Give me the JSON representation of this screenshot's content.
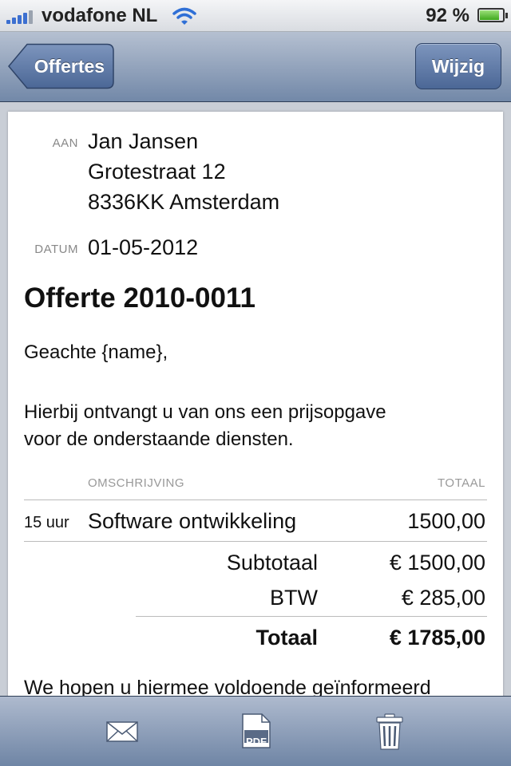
{
  "status_bar": {
    "carrier": "vodafone NL",
    "battery": "92 %",
    "battery_level": 0.92
  },
  "nav": {
    "back_label": "Offertes",
    "edit_label": "Wijzig"
  },
  "quote": {
    "to_label": "AAN",
    "to_name": "Jan Jansen",
    "to_street": "Grotestraat 12",
    "to_city": "8336KK Amsterdam",
    "date_label": "DATUM",
    "date": "01-05-2012",
    "title": "Offerte 2010-0011",
    "greeting": "Geachte {name},",
    "intro_line1": "Hierbij ontvangt u van ons een prijsopgave",
    "intro_line2": "voor de onderstaande diensten.",
    "col_description": "OMSCHRIJVING",
    "col_total": "TOTAAL",
    "items": [
      {
        "qty": "15 uur",
        "description": "Software ontwikkeling",
        "total": "1500,00"
      }
    ],
    "subtotal_label": "Subtotaal",
    "subtotal": "€ 1500,00",
    "vat_label": "BTW",
    "vat": "€ 285,00",
    "total_label": "Totaal",
    "total": "€ 1785,00",
    "closing": "We hopen u hiermee voldoende geïnformeerd"
  },
  "toolbar": {
    "icons": [
      "mail-icon",
      "pdf-icon",
      "trash-icon"
    ],
    "pdf_text": "PDF"
  },
  "colors": {
    "nav_top": "#b5c0d1",
    "nav_bottom": "#7288a8",
    "button": "#4b6796"
  }
}
